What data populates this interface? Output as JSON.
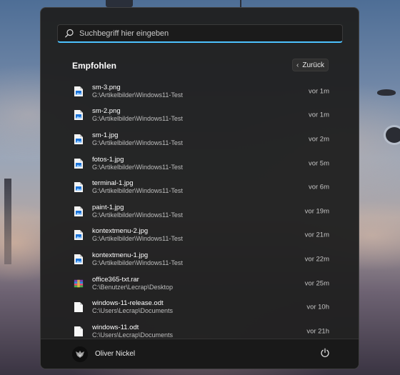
{
  "search": {
    "placeholder": "Suchbegriff hier eingeben",
    "icon": "search-icon"
  },
  "recommended": {
    "title": "Empfohlen",
    "back_label": "Zurück",
    "items": [
      {
        "name": "sm-3.png",
        "path": "G:\\Artikelbilder\\Windows11-Test",
        "time": "vor 1m",
        "icon": "image-file-icon"
      },
      {
        "name": "sm-2.png",
        "path": "G:\\Artikelbilder\\Windows11-Test",
        "time": "vor 1m",
        "icon": "image-file-icon"
      },
      {
        "name": "sm-1.jpg",
        "path": "G:\\Artikelbilder\\Windows11-Test",
        "time": "vor 2m",
        "icon": "image-file-icon"
      },
      {
        "name": "fotos-1.jpg",
        "path": "G:\\Artikelbilder\\Windows11-Test",
        "time": "vor 5m",
        "icon": "image-file-icon"
      },
      {
        "name": "terminal-1.jpg",
        "path": "G:\\Artikelbilder\\Windows11-Test",
        "time": "vor 6m",
        "icon": "image-file-icon"
      },
      {
        "name": "paint-1.jpg",
        "path": "G:\\Artikelbilder\\Windows11-Test",
        "time": "vor 19m",
        "icon": "image-file-icon"
      },
      {
        "name": "kontextmenu-2.jpg",
        "path": "G:\\Artikelbilder\\Windows11-Test",
        "time": "vor 21m",
        "icon": "image-file-icon"
      },
      {
        "name": "kontextmenu-1.jpg",
        "path": "G:\\Artikelbilder\\Windows11-Test",
        "time": "vor 22m",
        "icon": "image-file-icon"
      },
      {
        "name": "office365-txt.rar",
        "path": "C:\\Benutzer\\Lecrap\\Desktop",
        "time": "vor 25m",
        "icon": "archive-file-icon"
      },
      {
        "name": "windows-11-release.odt",
        "path": "C:\\Users\\Lecrap\\Documents",
        "time": "vor 10h",
        "icon": "document-file-icon"
      },
      {
        "name": "windows-11.odt",
        "path": "C:\\Users\\Lecrap\\Documents",
        "time": "vor 21h",
        "icon": "document-file-icon"
      }
    ]
  },
  "footer": {
    "user_name": "Oliver Nickel",
    "avatar_icon": "avatar",
    "power_icon": "power-icon"
  },
  "colors": {
    "accent": "#4cc2ff",
    "panel_bg": "#202020"
  }
}
